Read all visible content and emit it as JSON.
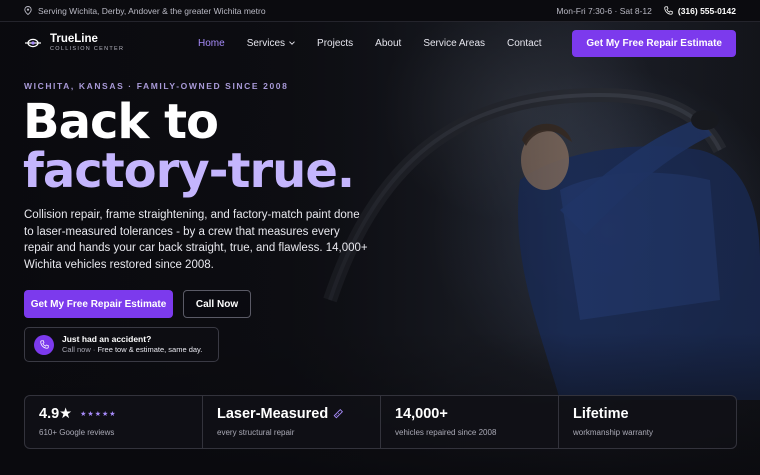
{
  "topbar": {
    "service_area": "Serving Wichita, Derby, Andover & the greater Wichita metro",
    "hours": "Mon-Fri 7:30-6 · Sat 8-12",
    "phone": "(316) 555-0142"
  },
  "brand": {
    "name": "TrueLine",
    "tagline": "COLLISION CENTER",
    "accent_color": "#7c3aed",
    "highlight_color": "#c4b5fd"
  },
  "nav": {
    "items": [
      {
        "label": "Home",
        "active": true
      },
      {
        "label": "Services",
        "active": false
      },
      {
        "label": "Projects",
        "active": false
      },
      {
        "label": "About",
        "active": false
      },
      {
        "label": "Service Areas",
        "active": false
      },
      {
        "label": "Contact",
        "active": false
      }
    ],
    "cta_label": "Get My Free Repair Estimate"
  },
  "hero": {
    "eyebrow": "WICHITA, KANSAS · FAMILY-OWNED SINCE 2008",
    "headline_line1": "Back to",
    "headline_line2": "factory-true.",
    "lede": "Collision repair, frame straightening, and factory-match paint done to laser-measured tolerances - by a crew that measures every repair and hands your car back straight, true, and flawless. 14,000+ Wichita vehicles restored since 2008.",
    "primary_button": "Get My Free Repair Estimate",
    "secondary_button": "Call Now",
    "accident": {
      "title": "Just had an accident?",
      "sub_prefix": "Call now · ",
      "sub_emphasis": "Free tow & estimate, same day."
    }
  },
  "stats": [
    {
      "value": "4.9★",
      "stars": "★★★★★",
      "label": "610+ Google reviews"
    },
    {
      "value": "Laser-Measured",
      "label": "every structural repair"
    },
    {
      "value": "14,000+",
      "label": "vehicles repaired since 2008"
    },
    {
      "value": "Lifetime",
      "label": "workmanship warranty"
    }
  ]
}
